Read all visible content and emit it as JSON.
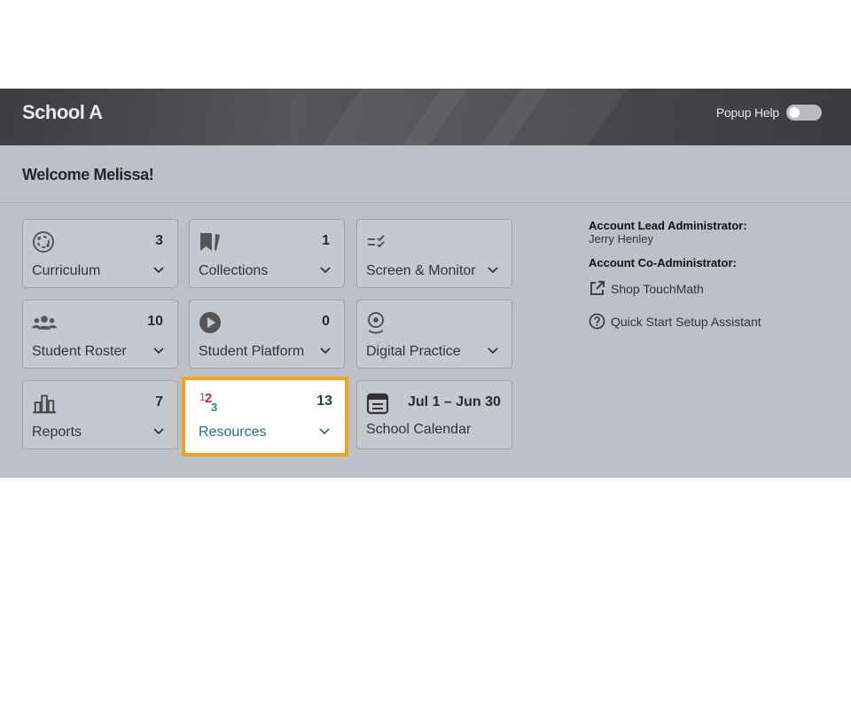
{
  "header": {
    "title": "School A",
    "popup_help_label": "Popup Help",
    "popup_help_enabled": false
  },
  "welcome": "Welcome Melissa!",
  "cards": [
    {
      "id": "curriculum",
      "label": "Curriculum",
      "count": "3",
      "icon": "curriculum-icon"
    },
    {
      "id": "collections",
      "label": "Collections",
      "count": "1",
      "icon": "collections-icon"
    },
    {
      "id": "screen-monitor",
      "label": "Screen & Monitor",
      "count": "",
      "icon": "screen-monitor-icon"
    },
    {
      "id": "student-roster",
      "label": "Student Roster",
      "count": "10",
      "icon": "students-icon"
    },
    {
      "id": "student-platform",
      "label": "Student Platform",
      "count": "0",
      "icon": "play-icon"
    },
    {
      "id": "digital-practice",
      "label": "Digital Practice",
      "count": "",
      "icon": "digital-practice-icon"
    },
    {
      "id": "reports",
      "label": "Reports",
      "count": "7",
      "icon": "reports-icon"
    },
    {
      "id": "resources",
      "label": "Resources",
      "count": "13",
      "icon": "resources-123-icon",
      "highlighted": true
    },
    {
      "id": "school-calendar",
      "label": "School Calendar",
      "date_range": "Jul 1 – Jun 30",
      "icon": "calendar-icon"
    }
  ],
  "account": {
    "lead_admin_label": "Account Lead Administrator:",
    "lead_admin_name": "Jerry Henley",
    "co_admin_label": "Account Co-Administrator:",
    "shop_link": "Shop TouchMath",
    "setup_link": "Quick Start Setup Assistant"
  },
  "colors": {
    "header_bg": "#45464a",
    "panel_bg": "#bdc0c7",
    "card_bg": "#c5c8ce",
    "highlight_border": "#f4a11b",
    "resources_label": "#2a6a96"
  }
}
